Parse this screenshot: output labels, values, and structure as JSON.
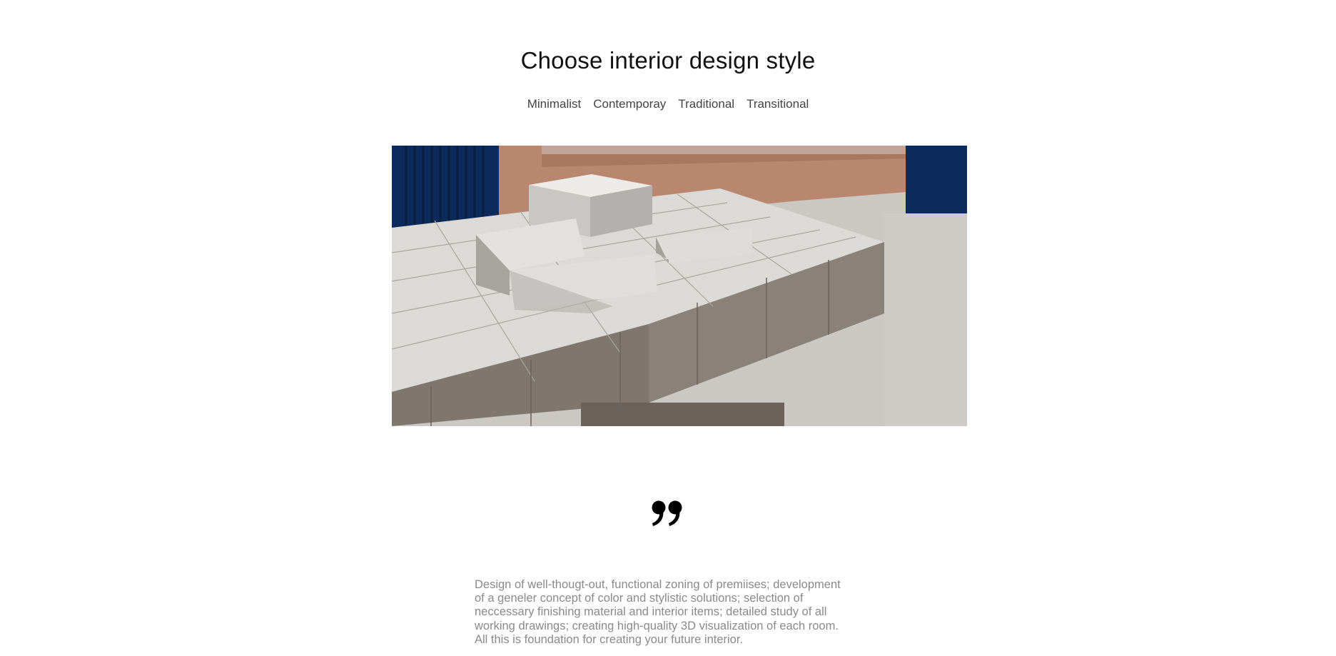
{
  "page": {
    "title": "Choose interior design style"
  },
  "tabs": [
    {
      "label": "Minimalist"
    },
    {
      "label": "Contemporay"
    },
    {
      "label": "Traditional"
    },
    {
      "label": "Transitional"
    }
  ],
  "hero_image": {
    "depicts": "interior-photo"
  },
  "quote": {
    "icon": "quote-icon",
    "lines": [
      "Design of well-thougt-out, functional zoning of premiises; development",
      "of a geneler concept of color and stylistic solutions; selection of",
      "neccessary finishing material and interior items; detailed study of all",
      "working drawings; creating high-quality 3D visualization of each room.",
      "All this is foundation for creating your future interior."
    ]
  },
  "colors": {
    "navy": "#0c2a5b",
    "terracotta": "#b98670",
    "concrete": "#c8c4bf",
    "text_gray": "#8a8a8a"
  }
}
